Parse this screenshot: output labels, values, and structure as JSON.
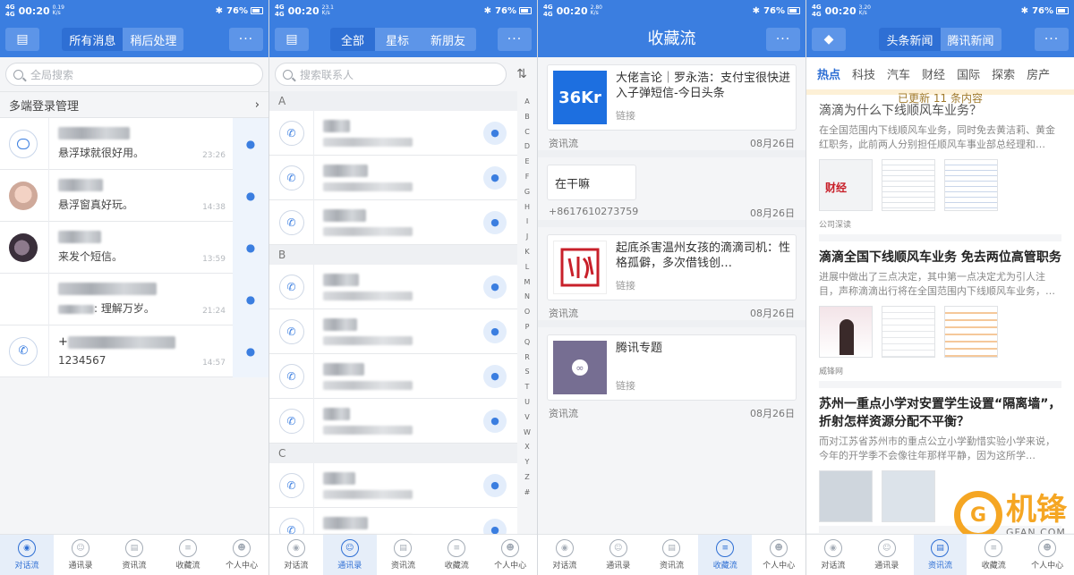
{
  "status": [
    {
      "time": "00:20",
      "net": "0.19 K/s",
      "battery": "76%"
    },
    {
      "time": "00:20",
      "net": "23.1 K/s",
      "battery": "76%"
    },
    {
      "time": "00:20",
      "net": "2.80 K/s",
      "battery": "76%"
    },
    {
      "time": "00:20",
      "net": "3.20 K/s",
      "battery": "76%"
    }
  ],
  "s1": {
    "seg": [
      "所有消息",
      "稍后处理"
    ],
    "search_placeholder": "全局搜索",
    "group": "多端登录管理",
    "messages": [
      {
        "text": "悬浮球就很好用。",
        "time": "23:26"
      },
      {
        "text": "悬浮窗真好玩。",
        "time": "14:38"
      },
      {
        "text": "来发个短信。",
        "time": "13:59"
      },
      {
        "text": ": 理解万岁。",
        "time": "21:24"
      },
      {
        "name": "+",
        "text": "1234567",
        "time": "14:57"
      }
    ]
  },
  "s2": {
    "seg": [
      "全部",
      "星标",
      "新朋友"
    ],
    "search_placeholder": "搜索联系人",
    "letters": [
      "A",
      "B",
      "C"
    ],
    "alphabet": [
      "A",
      "B",
      "C",
      "D",
      "E",
      "F",
      "G",
      "H",
      "I",
      "J",
      "K",
      "L",
      "M",
      "N",
      "O",
      "P",
      "Q",
      "R",
      "S",
      "T",
      "U",
      "V",
      "W",
      "X",
      "Y",
      "Z",
      "#"
    ]
  },
  "s3": {
    "title": "收藏流",
    "cards": [
      {
        "title": "大佬言论｜罗永浩：支付宝很快进入子弹短信-今日头条",
        "link": "链接",
        "source": "资讯流",
        "date": "08月26日",
        "thumb": "36Kr"
      },
      {
        "title": "在干嘛",
        "source": "+8617610273759",
        "date": "08月26日"
      },
      {
        "title": "起底杀害温州女孩的滴滴司机：性格孤僻，多次借钱创…",
        "link": "链接",
        "source": "资讯流",
        "date": "08月26日"
      },
      {
        "title": "腾讯专题",
        "link": "链接",
        "source": "资讯流",
        "date": "08月26日"
      }
    ]
  },
  "s4": {
    "seg": [
      "头条新闻",
      "腾讯新闻"
    ],
    "tabs": [
      "热点",
      "科技",
      "汽车",
      "财经",
      "国际",
      "探索",
      "房产"
    ],
    "banner": "已更新 11 条内容",
    "news": [
      {
        "title": "滴滴为什么下线顺风车业务？",
        "summary": "在全国范围内下线顺风车业务，同时免去黄洁莉、黄金红职务，此前两人分别担任顺风车事业部总经理和…",
        "source": "公司深读"
      },
      {
        "title": "滴滴全国下线顺风车业务 免去两位高管职务",
        "summary": "进展中做出了三点决定，其中第一点决定尤为引人注目，声称滴滴出行将在全国范围内下线顺风车业务，…",
        "source": "威锋网"
      },
      {
        "title": "苏州一重点小学对安置学生设置“隔离墙”，折射怎样资源分配不平衡？",
        "summary": "而对江苏省苏州市的重点公立小学勤惜实验小学来说，今年的开学季不会像往年那样平静，因为这所学…",
        "source": ""
      }
    ]
  },
  "tabs": [
    "对话流",
    "通讯录",
    "资讯流",
    "收藏流",
    "个人中心"
  ],
  "watermark": {
    "cn": "机锋",
    "en": "GFAN.COM"
  },
  "colors": {
    "primary": "#3b7ee0",
    "accent": "#f5a623"
  }
}
